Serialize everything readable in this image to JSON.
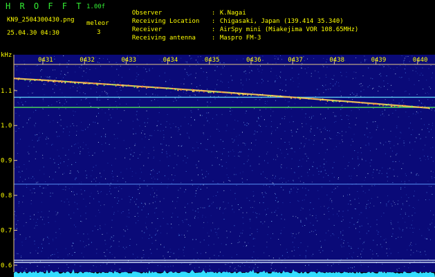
{
  "header": {
    "app_title": "H R O F F T",
    "app_version": "1.00f",
    "file_name": "KN9_2504300430.png",
    "timestamp": "25.04.30 04:30",
    "mode_label": "meleor",
    "mode_value": "3",
    "info": [
      {
        "key": "Observer",
        "sep": ":",
        "value": "K.Nagai"
      },
      {
        "key": "Receiving Location",
        "sep": ":",
        "value": "Chigasaki, Japan (139.414 35.340)"
      },
      {
        "key": "Receiver",
        "sep": ":",
        "value": "AirSpy mini (Miakejima VOR 108.65MHz)"
      },
      {
        "key": "Receiving antenna",
        "sep": ":",
        "value": "Maspro FM-3"
      }
    ]
  },
  "chart_data": {
    "type": "heatmap",
    "title": "",
    "ylabel": "kHz",
    "ylim": [
      0.58,
      1.175
    ],
    "y_ticks": [
      "1.1",
      "1.0",
      "0.9",
      "0.8",
      "0.7",
      "0.6"
    ],
    "y_tick_values": [
      1.1,
      1.0,
      0.9,
      0.8,
      0.7,
      0.6
    ],
    "x_ticks": [
      "0431",
      "0432",
      "0433",
      "0434",
      "0435",
      "0436",
      "0437",
      "0438",
      "0439",
      "0440"
    ],
    "background_color": "#0a0a78",
    "noise_color": "#5aa0ff",
    "line_color": "#e8c888",
    "meteor_trace": {
      "x_start": "0430",
      "x_end": "0440",
      "y_start": 1.135,
      "y_end": 1.05,
      "color": "#ffcc55"
    },
    "constant_lines": [
      {
        "y": 1.081,
        "color": "#66e0ff"
      },
      {
        "y": 1.052,
        "color": "#55ff55"
      },
      {
        "y": 0.832,
        "color": "#4a78e0"
      },
      {
        "y": 0.614,
        "color": "#ddeeff"
      },
      {
        "y": 0.608,
        "color": "#ddeeff"
      }
    ],
    "grid": false
  }
}
